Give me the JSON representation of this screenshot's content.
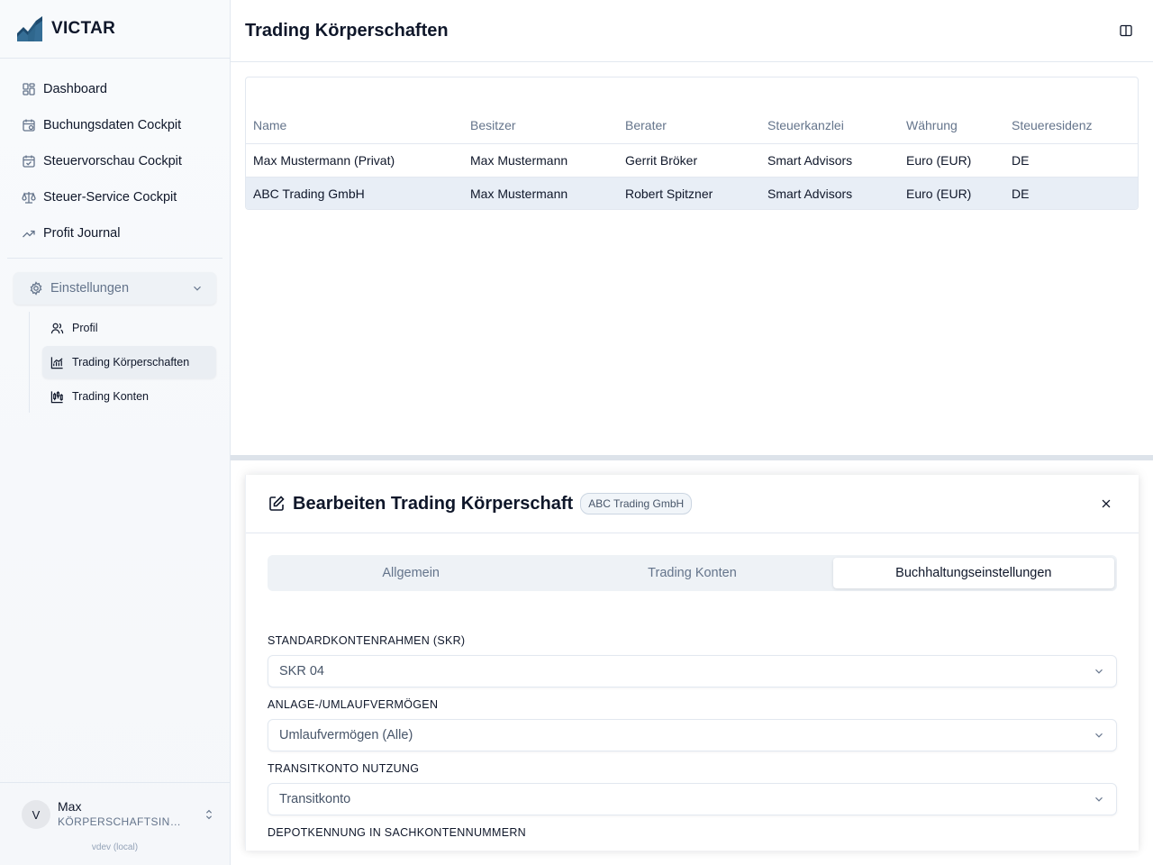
{
  "brand": {
    "name": "VICTAR",
    "accent": "#1e4a6e"
  },
  "sidebar": {
    "nav": [
      {
        "label": "Dashboard",
        "icon": "dashboard-icon"
      },
      {
        "label": "Buchungsdaten Cockpit",
        "icon": "calendar-clock-icon"
      },
      {
        "label": "Steuervorschau Cockpit",
        "icon": "calendar-check-icon"
      },
      {
        "label": "Steuer-Service Cockpit",
        "icon": "scale-icon"
      },
      {
        "label": "Profit Journal",
        "icon": "trending-up-icon"
      }
    ],
    "settings": {
      "label": "Einstellungen",
      "expanded": true,
      "items": [
        {
          "label": "Profil",
          "icon": "users-icon"
        },
        {
          "label": "Trading Körperschaften",
          "icon": "chart-area-icon",
          "active": true
        },
        {
          "label": "Trading Konten",
          "icon": "chart-candlestick-icon"
        }
      ]
    },
    "user": {
      "initial": "V",
      "name": "Max",
      "role": "KÖRPERSCHAFTSINH..."
    },
    "version": "vdev (local)"
  },
  "header": {
    "title": "Trading Körperschaften"
  },
  "table": {
    "columns": [
      "Name",
      "Besitzer",
      "Berater",
      "Steuerkanzlei",
      "Währung",
      "Steueresidenz"
    ],
    "rows": [
      [
        "Max Mustermann (Privat)",
        "Max Mustermann",
        "Gerrit Bröker",
        "Smart Advisors",
        "Euro (EUR)",
        "DE"
      ],
      [
        "ABC Trading GmbH",
        "Max Mustermann",
        "Robert Spitzner",
        "Smart Advisors",
        "Euro (EUR)",
        "DE"
      ]
    ],
    "selected_row": 1
  },
  "editor": {
    "title": "Bearbeiten Trading Körperschaft",
    "badge": "ABC Trading GmbH",
    "tabs": [
      {
        "label": "Allgemein"
      },
      {
        "label": "Trading Konten"
      },
      {
        "label": "Buchhaltungseinstellungen",
        "active": true
      }
    ],
    "fields": [
      {
        "label": "STANDARDKONTENRAHMEN (SKR)",
        "value": "SKR 04"
      },
      {
        "label": "ANLAGE-/UMLAUFVERMÖGEN",
        "value": "Umlaufvermögen (Alle)"
      },
      {
        "label": "TRANSITKONTO NUTZUNG",
        "value": "Transitkonto"
      },
      {
        "label": "DEPOTKENNUNG IN SACHKONTENNUMMERN",
        "value": ""
      }
    ]
  }
}
